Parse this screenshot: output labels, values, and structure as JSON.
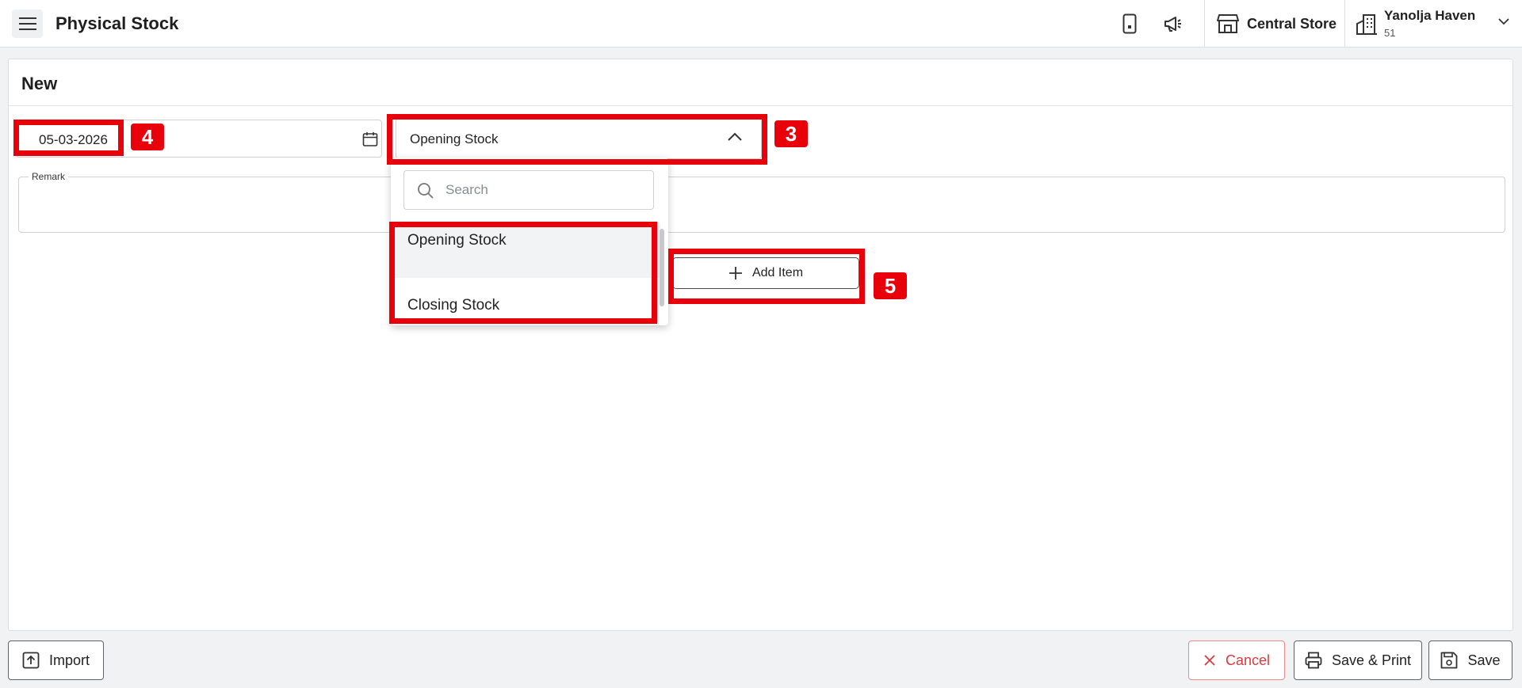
{
  "header": {
    "title": "Physical Stock",
    "store_name": "Central Store",
    "user_name": "Yanolja Haven",
    "user_id": "51"
  },
  "form": {
    "title": "New",
    "date_value": "05-03-2026",
    "stock_type_value": "Opening Stock",
    "remark_label": "Remark",
    "add_item_label": "Add Item"
  },
  "dropdown": {
    "search_placeholder": "Search",
    "options": [
      "Opening Stock",
      "Closing Stock"
    ]
  },
  "annotations": {
    "tag_3": "3",
    "tag_4": "4",
    "tag_5": "5",
    "color": "#e8000b"
  },
  "footer": {
    "import_label": "Import",
    "cancel_label": "Cancel",
    "save_print_label": "Save & Print",
    "save_label": "Save"
  },
  "icons": {
    "menu": "hamburger-icon",
    "mobile": "mobile-phone-icon",
    "announce": "megaphone-icon",
    "store": "storefront-icon",
    "building": "building-icon",
    "calendar": "calendar-icon",
    "search": "search-icon",
    "plus": "plus-icon",
    "import": "upload-icon",
    "cancel": "close-icon",
    "print": "printer-icon",
    "save": "floppy-disk-icon"
  }
}
